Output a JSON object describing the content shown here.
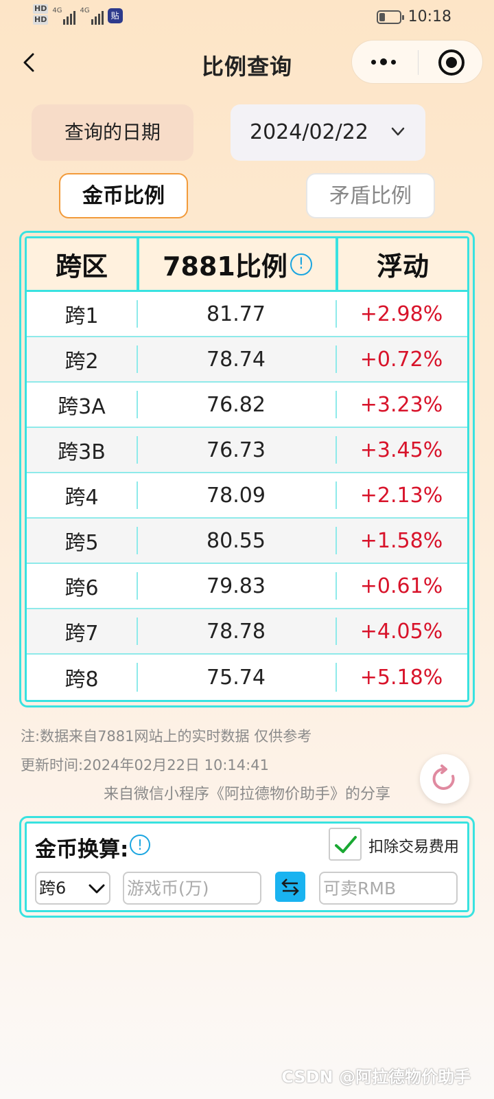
{
  "status_bar": {
    "time": "10:18",
    "app_icon_text": "贴",
    "hd1": "HD",
    "hd2": "HD",
    "sig1": "4G",
    "sig2": "4G",
    "battery_level": 0.3
  },
  "nav": {
    "title": "比例查询"
  },
  "date": {
    "label": "查询的日期",
    "value": "2024/02/22"
  },
  "tabs": {
    "gold": "金币比例",
    "shield": "矛盾比例"
  },
  "table": {
    "headers": {
      "zone": "跨区",
      "ratio": "7881比例",
      "change": "浮动",
      "info_icon": "!"
    },
    "rows": [
      {
        "zone": "跨1",
        "ratio": "81.77",
        "change": "+2.98%"
      },
      {
        "zone": "跨2",
        "ratio": "78.74",
        "change": "+0.72%"
      },
      {
        "zone": "跨3A",
        "ratio": "76.82",
        "change": "+3.23%"
      },
      {
        "zone": "跨3B",
        "ratio": "76.73",
        "change": "+3.45%"
      },
      {
        "zone": "跨4",
        "ratio": "78.09",
        "change": "+2.13%"
      },
      {
        "zone": "跨5",
        "ratio": "80.55",
        "change": "+1.58%"
      },
      {
        "zone": "跨6",
        "ratio": "79.83",
        "change": "+0.61%"
      },
      {
        "zone": "跨7",
        "ratio": "78.78",
        "change": "+4.05%"
      },
      {
        "zone": "跨8",
        "ratio": "75.74",
        "change": "+5.18%"
      }
    ]
  },
  "notes": {
    "source": "注:数据来自7881网站上的实时数据 仅供参考",
    "updated": "更新时间:2024年02月22日 10:14:41",
    "share": "来自微信小程序《阿拉德物价助手》的分享"
  },
  "converter": {
    "title": "金币换算:",
    "info_icon": "!",
    "deduct_fee_label": "扣除交易费用",
    "deduct_fee_checked": true,
    "zone_selected": "跨6",
    "coin_placeholder": "游戏币(万)",
    "rmb_placeholder": "可卖RMB"
  },
  "watermark": "CSDN @阿拉德物价助手",
  "colors": {
    "accent_cyan": "#39e2e0",
    "change_red": "#d8132a",
    "tab_orange": "#f29a3a",
    "swap_blue": "#1ab3f0"
  }
}
